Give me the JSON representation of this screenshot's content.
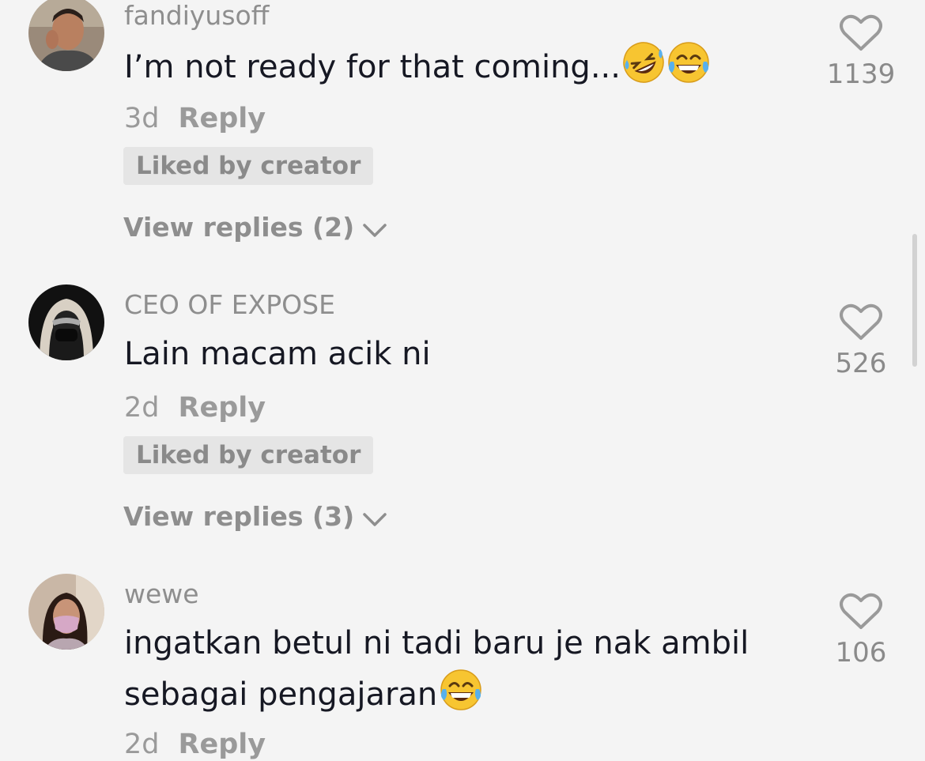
{
  "comments": [
    {
      "username": "fandiyusoff",
      "text_lines": [
        "I’m not ready for that coming..."
      ],
      "emojis": [
        "rolling-on-floor-laughing-emoji",
        "tears-of-joy-emoji"
      ],
      "age": "3d",
      "reply_label": "Reply",
      "badge": "Liked by creator",
      "view_replies": "View replies (2)",
      "likes": "1139"
    },
    {
      "username": "CEO OF EXPOSE",
      "text_lines": [
        "Lain macam acik ni"
      ],
      "emojis": [],
      "age": "2d",
      "reply_label": "Reply",
      "badge": "Liked by creator",
      "view_replies": "View replies (3)",
      "likes": "526"
    },
    {
      "username": "wewe",
      "text_lines": [
        "ingatkan betul ni tadi baru je nak ambil",
        "sebagai pengajaran"
      ],
      "emojis": [
        "tears-of-joy-emoji"
      ],
      "age": "2d",
      "reply_label": "Reply",
      "likes": "106"
    }
  ],
  "colors": {
    "background": "#f4f4f4",
    "username": "#8e8e8e",
    "text": "#161823",
    "badge_bg": "#e5e5e5",
    "secondary": "#9a9a9a"
  }
}
